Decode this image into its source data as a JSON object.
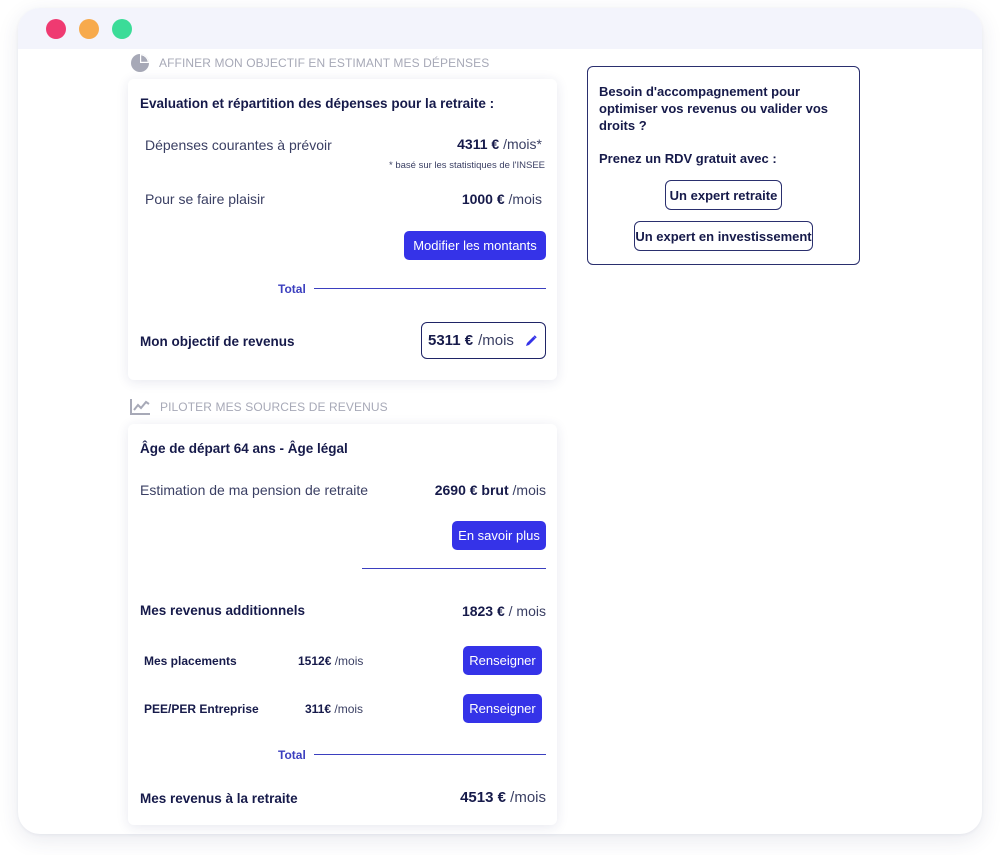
{
  "window": {
    "controls": [
      "close",
      "minimize",
      "maximize"
    ]
  },
  "section1": {
    "heading": "AFFINER MON OBJECTIF EN ESTIMANT MES DÉPENSES",
    "icon": "pie-chart-icon",
    "card": {
      "title": "Evaluation et répartition des dépenses pour la retraite :",
      "rows": [
        {
          "label": "Dépenses courantes à prévoir",
          "amount": "4311 €",
          "unit": "/mois*",
          "note": "* basé sur les statistiques de l'INSEE"
        },
        {
          "label": "Pour se faire plaisir",
          "amount": "1000 €",
          "unit": "/mois"
        }
      ],
      "modify_button": "Modifier les montants",
      "total_label": "Total",
      "objective_label": "Mon objectif de revenus",
      "objective_amount": "5311 €",
      "objective_unit": "/mois",
      "edit_icon": "pencil-icon"
    }
  },
  "section2": {
    "heading": "PILOTER MES SOURCES DE REVENUS",
    "icon": "line-chart-icon",
    "card": {
      "age_title": "Âge de départ  64 ans - Âge légal",
      "pension_label": "Estimation de ma pension de retraite",
      "pension_amount": "2690 € brut",
      "pension_unit": "/mois",
      "more_button": "En savoir plus",
      "additional_label": "Mes revenus additionnels",
      "additional_amount": "1823 €",
      "additional_unit": "/ mois",
      "items": [
        {
          "label": "Mes placements",
          "amount": "1512€",
          "unit": "/mois",
          "button": "Renseigner"
        },
        {
          "label": "PEE/PER Entreprise",
          "amount": "311€",
          "unit": "/mois",
          "button": "Renseigner"
        }
      ],
      "total_label": "Total",
      "retirement_label": "Mes revenus à la retraite",
      "retirement_amount": "4513 €",
      "retirement_unit": "/mois"
    }
  },
  "side": {
    "question": "Besoin d'accompagnement pour optimiser vos revenus ou valider vos droits ?",
    "cta": "Prenez un RDV gratuit avec :",
    "buttons": [
      "Un expert retraite",
      "Un expert en investissement"
    ]
  },
  "colors": {
    "accent": "#3533e8",
    "navy": "#161a4a",
    "muted": "#a7a9b7"
  }
}
